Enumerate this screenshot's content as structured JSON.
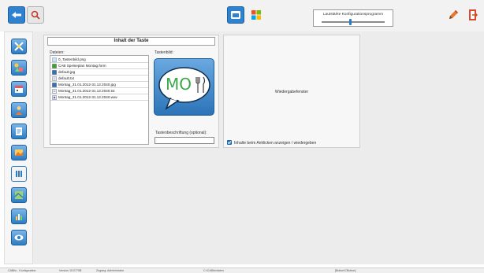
{
  "toolbar": {
    "volume_label": "Lautstärke Konfigurationsprogramm",
    "volume_level": 0.45,
    "icons": [
      "back-arrow-icon",
      "search-icon",
      "window-icon",
      "windows-logo-icon",
      "edit-icon",
      "exit-icon"
    ]
  },
  "sidebar": {
    "items": [
      "tools-icon",
      "shapes-icon",
      "calendar-icon",
      "person-icon",
      "notes-icon",
      "image-icon",
      "bars-icon",
      "map-icon",
      "chart-icon",
      "eye-icon"
    ]
  },
  "content": {
    "title": "Inhalt der Taste",
    "files_label": "Dateien:",
    "files": [
      "0_Tastenbild.png",
      "CAB Speiseplan Montag.form",
      "default.jpg",
      "default.txt",
      "Montag_31.01.2012-31.12.2040.jpg",
      "Montag_31.01.2012-31.12.2040.txt",
      "Montag_31.01.2012-31.12.2040.wav"
    ],
    "image_label": "Tastenbild:",
    "image_text": "MO",
    "caption_label": "Tastenbeschriftung (optional):",
    "caption_value": ""
  },
  "player": {
    "label": "Wiedergabefenster",
    "checkbox_label": "Inhalte beim Anklicken anzeigen / wiedergeben",
    "checked": true
  },
  "status": {
    "app": "CABito - Konfiguration",
    "version": "Version 15.0770B",
    "user": "Zugang: Administrator",
    "path": "C:\\CABito\\daten",
    "button": "[Button\\CButton]"
  },
  "colors": {
    "accent": "#2c7cc4",
    "bubble": "#3a86c9",
    "exit": "#d84a2a"
  }
}
